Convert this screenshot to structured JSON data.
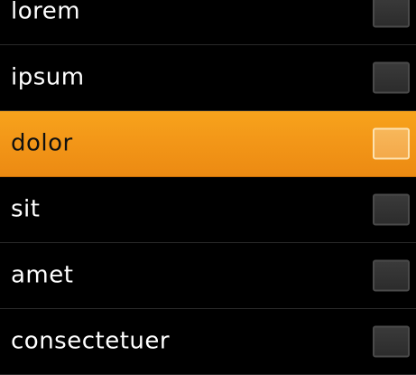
{
  "list": {
    "items": [
      {
        "label": "lorem",
        "selected": false,
        "checked": false
      },
      {
        "label": "ipsum",
        "selected": false,
        "checked": false
      },
      {
        "label": "dolor",
        "selected": true,
        "checked": false
      },
      {
        "label": "sit",
        "selected": false,
        "checked": false
      },
      {
        "label": "amet",
        "selected": false,
        "checked": false
      },
      {
        "label": "consectetuer",
        "selected": false,
        "checked": false
      }
    ]
  },
  "colors": {
    "background": "#000000",
    "selected_row": "#f39718",
    "divider": "#2a2a2a",
    "text": "#ffffff",
    "selected_text": "#111111"
  }
}
